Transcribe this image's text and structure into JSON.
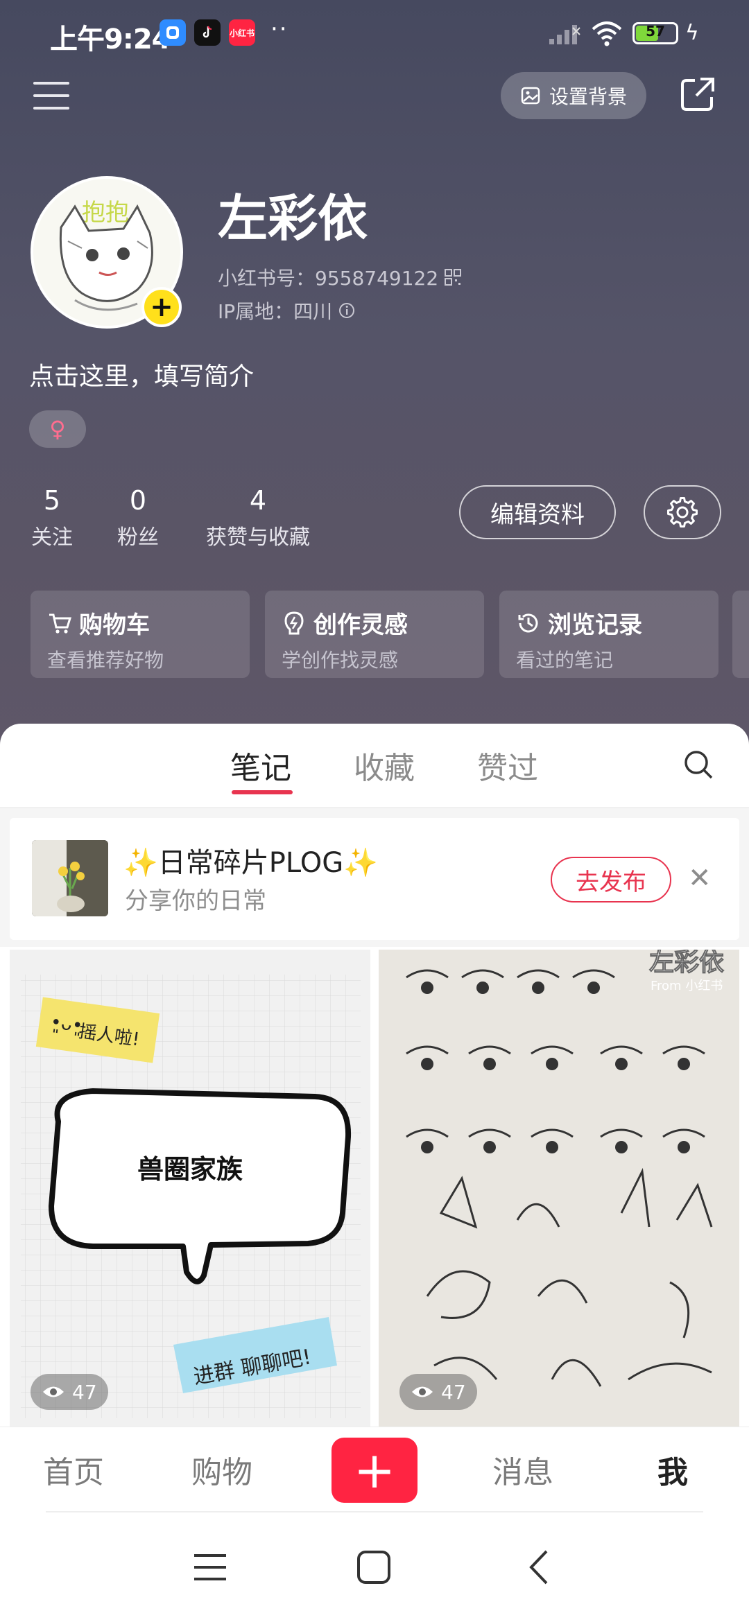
{
  "status_bar": {
    "time": "上午9:24",
    "battery": "57",
    "app3": "小红书"
  },
  "header": {
    "set_background_label": "设置背景"
  },
  "profile": {
    "nickname": "左彩依",
    "red_id_label": "小红书号：9558749122",
    "ip_label": "IP属地：四川",
    "bio_placeholder": "点击这里，填写简介",
    "gender_symbol": "♀",
    "avatar_text": "抱抱"
  },
  "stats": [
    {
      "value": "5",
      "label": "关注"
    },
    {
      "value": "0",
      "label": "粉丝"
    },
    {
      "value": "4",
      "label": "获赞与收藏"
    }
  ],
  "edit_profile_label": "编辑资料",
  "quick_cards": [
    {
      "title": "购物车",
      "subtitle": "查看推荐好物",
      "icon": "cart-icon"
    },
    {
      "title": "创作灵感",
      "subtitle": "学创作找灵感",
      "icon": "bulb-icon"
    },
    {
      "title": "浏览记录",
      "subtitle": "看过的笔记",
      "icon": "clock-icon"
    }
  ],
  "tabs": [
    {
      "label": "笔记",
      "active": true
    },
    {
      "label": "收藏",
      "active": false
    },
    {
      "label": "赞过",
      "active": false
    }
  ],
  "banner": {
    "title": "✨日常碎片PLOG✨",
    "subtitle": "分享你的日常",
    "button": "去发布"
  },
  "posts": [
    {
      "views": "47",
      "sticker_top": "摇人啦!",
      "bubble_text": "兽圈家族",
      "sticker_bottom": "进群 聊聊吧!"
    },
    {
      "views": "47",
      "watermark": "左彩依",
      "watermark_sub": "From 小红书"
    }
  ],
  "bottom_nav": [
    {
      "label": "首页",
      "active": false
    },
    {
      "label": "购物",
      "active": false
    },
    {
      "label": "消息",
      "active": false
    },
    {
      "label": "我",
      "active": true
    }
  ],
  "colors": {
    "accent": "#ff2442",
    "tab_underline": "#e8344f",
    "header_bg": "#4f4f63"
  }
}
